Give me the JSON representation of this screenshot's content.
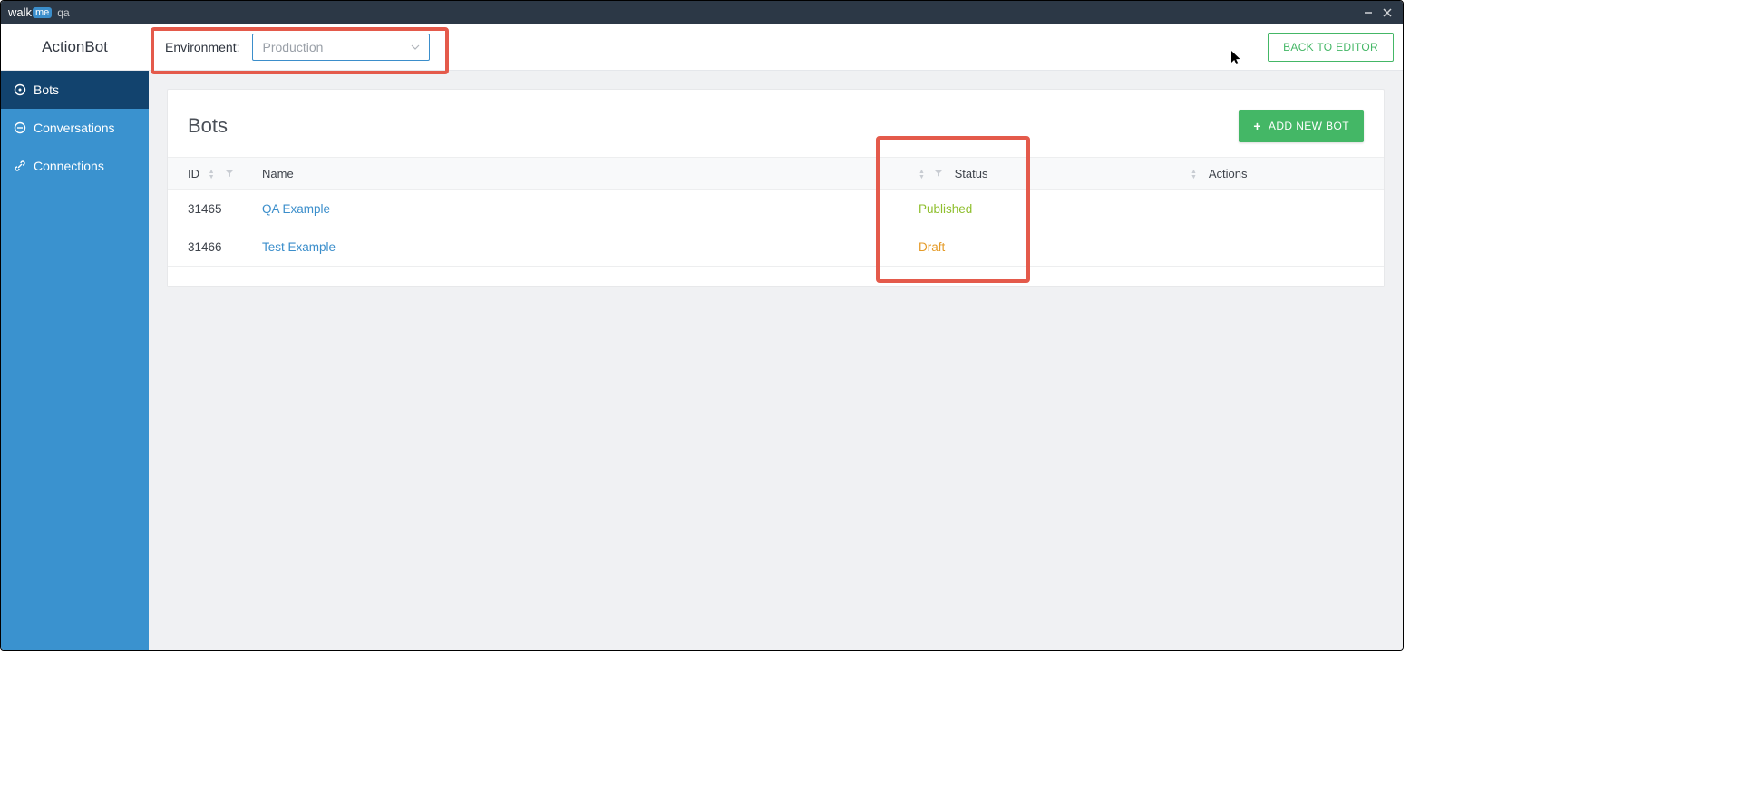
{
  "titlebar": {
    "brand_walk": "walk",
    "brand_me": "me",
    "env_text": "qa"
  },
  "topbar": {
    "app_name": "ActionBot",
    "env_label": "Environment:",
    "env_value": "Production",
    "back_button": "BACK TO EDITOR"
  },
  "sidebar": {
    "items": [
      {
        "label": "Bots",
        "icon": "bots-icon",
        "active": true
      },
      {
        "label": "Conversations",
        "icon": "conversations-icon",
        "active": false
      },
      {
        "label": "Connections",
        "icon": "connections-icon",
        "active": false
      }
    ]
  },
  "page": {
    "title": "Bots",
    "add_button": "ADD NEW BOT",
    "columns": {
      "id": "ID",
      "name": "Name",
      "status": "Status",
      "actions": "Actions"
    },
    "rows": [
      {
        "id": "31465",
        "name": "QA Example",
        "status": "Published",
        "status_class": "status-published"
      },
      {
        "id": "31466",
        "name": "Test Example",
        "status": "Draft",
        "status_class": "status-draft"
      }
    ]
  }
}
